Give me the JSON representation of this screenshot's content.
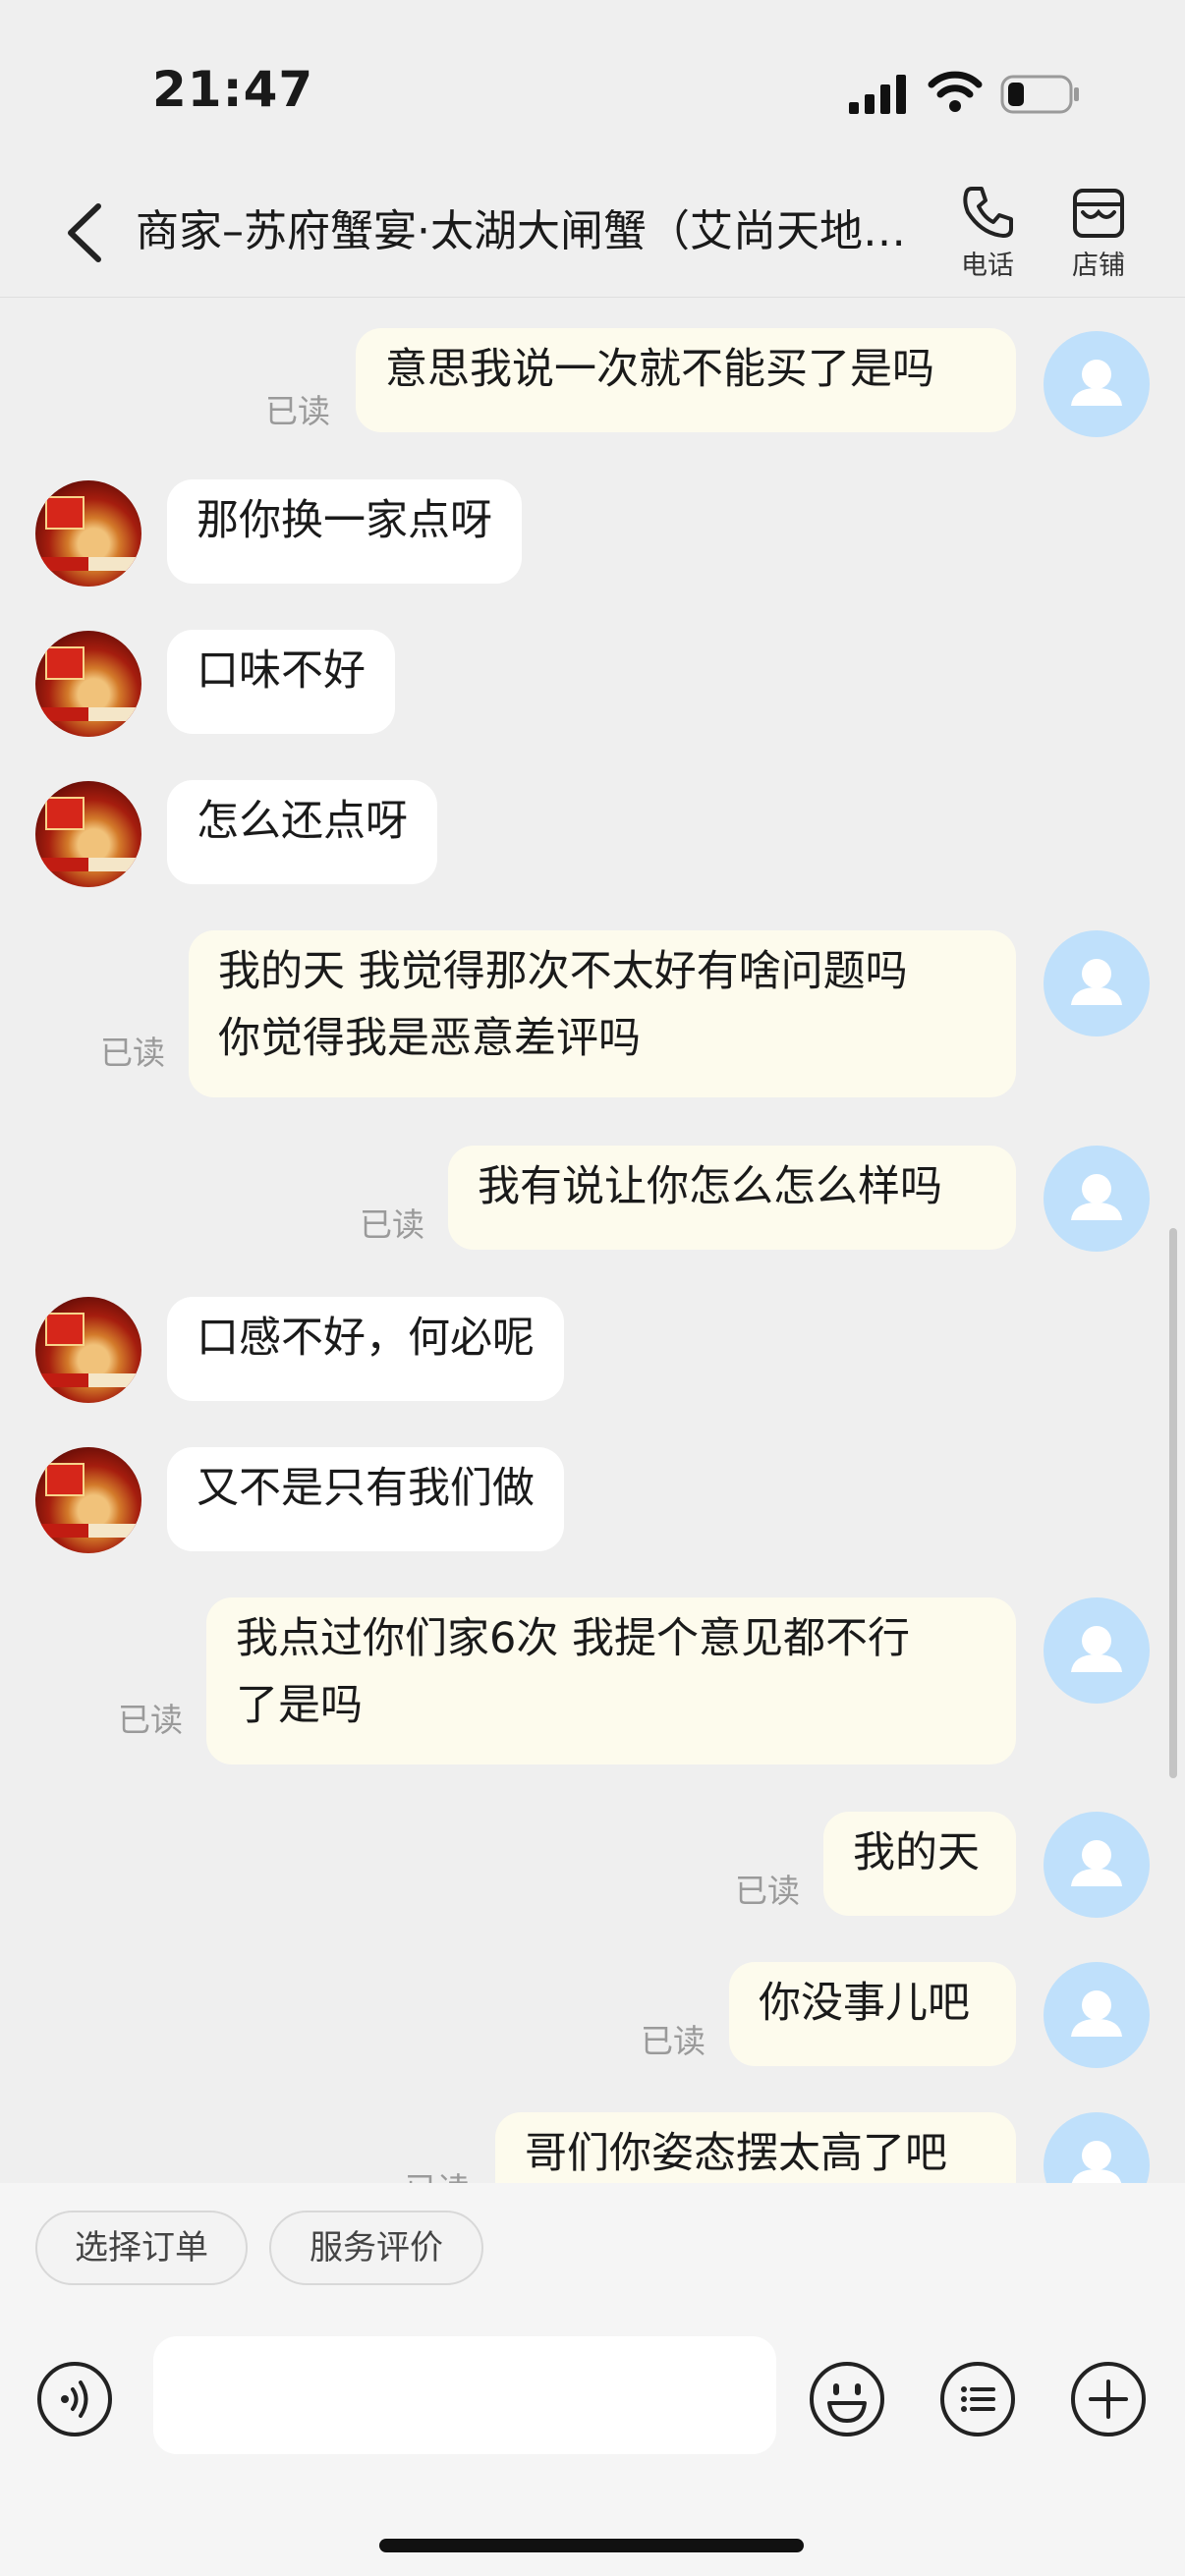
{
  "status_bar": {
    "time": "21:47"
  },
  "nav": {
    "title": "商家–苏府蟹宴·太湖大闸蟹（艾尚天地店）",
    "phone_label": "电话",
    "store_label": "店铺"
  },
  "messages": [
    {
      "side": "out",
      "lines": [
        "意思我说一次就不能买了是吗"
      ],
      "status": "已读"
    },
    {
      "side": "in",
      "lines": [
        "那你换一家点呀"
      ]
    },
    {
      "side": "in",
      "lines": [
        "口味不好"
      ]
    },
    {
      "side": "in",
      "lines": [
        "怎么还点呀"
      ]
    },
    {
      "side": "out",
      "lines": [
        "我的天 我觉得那次不太好有啥问题吗",
        "你觉得我是恶意差评吗"
      ],
      "status": "已读"
    },
    {
      "side": "out",
      "lines": [
        "我有说让你怎么怎么样吗"
      ],
      "status": "已读"
    },
    {
      "side": "in",
      "lines": [
        "口感不好，何必呢"
      ]
    },
    {
      "side": "in",
      "lines": [
        "又不是只有我们做"
      ]
    },
    {
      "side": "out",
      "lines": [
        "我点过你们家6次 我提个意见都不行",
        "了是吗"
      ],
      "status": "已读"
    },
    {
      "side": "out",
      "lines": [
        "我的天"
      ],
      "status": "已读"
    },
    {
      "side": "out",
      "lines": [
        "你没事儿吧"
      ],
      "status": "已读"
    },
    {
      "side": "out",
      "lines": [
        "哥们你姿态摆太高了吧"
      ],
      "status": "已读"
    }
  ],
  "quick_actions": {
    "select_order": "选择订单",
    "service_review": "服务评价"
  },
  "input": {
    "placeholder": ""
  },
  "icons": {
    "back": "chevron-left-icon",
    "phone": "phone-icon",
    "store": "store-icon",
    "voice": "voice-icon",
    "emoji": "emoji-icon",
    "menu": "list-menu-icon",
    "plus": "plus-icon"
  },
  "colors": {
    "outgoing_bubble": "#fdfbed",
    "incoming_bubble": "#ffffff",
    "user_avatar": "#bfe0fb",
    "read_text": "#9a9a9a"
  }
}
